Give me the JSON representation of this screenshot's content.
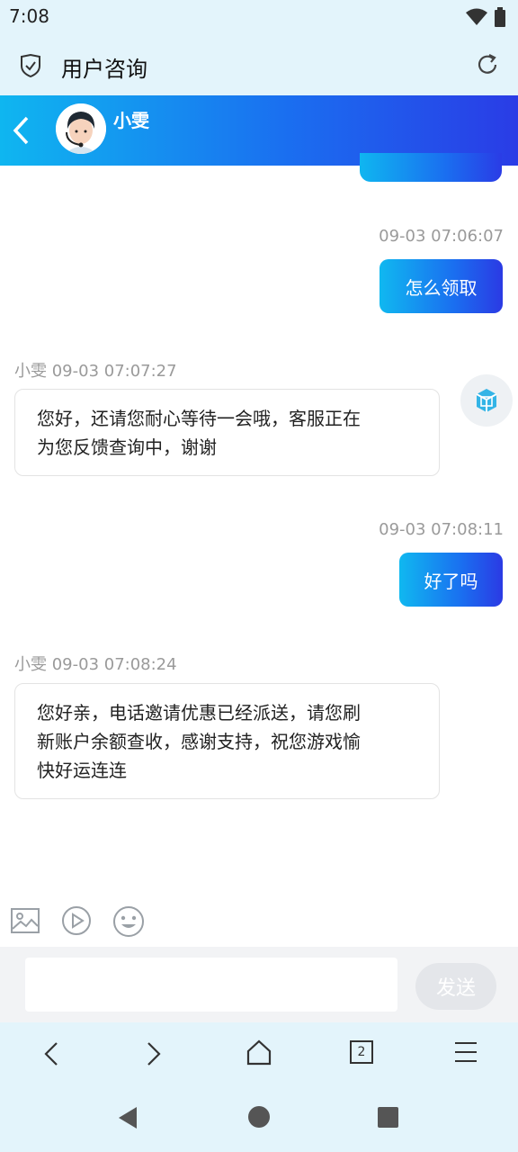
{
  "status_bar": {
    "time": "7:08"
  },
  "browser": {
    "title": "用户咨询",
    "tab_count": "2"
  },
  "chat": {
    "agent_name": "小雯",
    "messages": [
      {
        "from": "user",
        "time": "09-03 07:06:07",
        "text": "怎么领取"
      },
      {
        "from": "agent",
        "header": "小雯 09-03 07:07:27",
        "lines": [
          "您好，还请您耐心等待一会哦，客服正在",
          "为您反馈查询中，谢谢"
        ]
      },
      {
        "from": "user",
        "time": "09-03 07:08:11",
        "text": "好了吗"
      },
      {
        "from": "agent",
        "header": "小雯 09-03 07:08:24",
        "lines": [
          "您好亲，电话邀请优惠已经派送，请您刷",
          "新账户余额查收，感谢支持，祝您游戏愉",
          "快好运连连"
        ]
      }
    ]
  },
  "composer": {
    "send_label": "发送",
    "input_value": ""
  },
  "colors": {
    "accent": "#1a6ff0",
    "header_start": "#0fb6f0",
    "header_end": "#2a3ce6"
  }
}
